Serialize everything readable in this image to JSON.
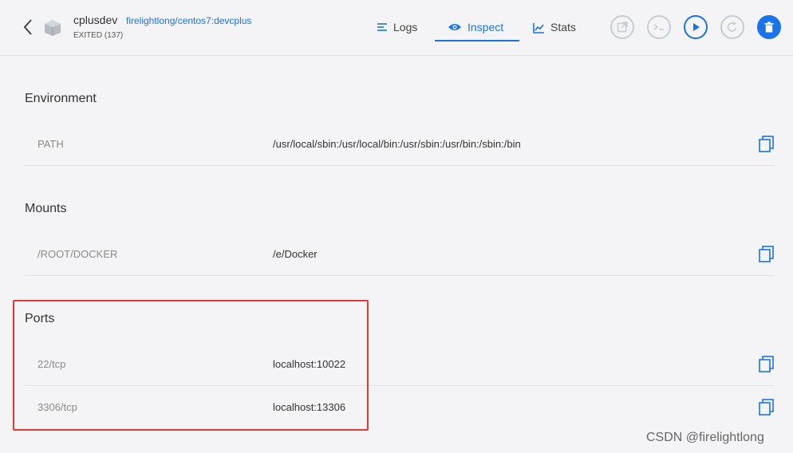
{
  "header": {
    "container_name": "cplusdev",
    "image_name": "firelightlong/centos7:devcplus",
    "status": "EXITED (137)",
    "tabs": [
      {
        "label": "Logs",
        "icon": "logs-icon",
        "active": false
      },
      {
        "label": "Inspect",
        "icon": "eye-icon",
        "active": true
      },
      {
        "label": "Stats",
        "icon": "stats-icon",
        "active": false
      }
    ],
    "actions": [
      "open-in-browser-icon",
      "cli-icon",
      "start-icon",
      "restart-icon",
      "delete-icon"
    ]
  },
  "environment": {
    "title": "Environment",
    "rows": [
      {
        "key": "PATH",
        "value": "/usr/local/sbin:/usr/local/bin:/usr/sbin:/usr/bin:/sbin:/bin"
      }
    ]
  },
  "mounts": {
    "title": "Mounts",
    "rows": [
      {
        "key": "/ROOT/DOCKER",
        "value": "/e/Docker"
      }
    ]
  },
  "ports": {
    "title": "Ports",
    "rows": [
      {
        "key": "22/tcp",
        "value": "localhost:10022"
      },
      {
        "key": "3306/tcp",
        "value": "localhost:13306"
      }
    ]
  },
  "watermark": "CSDN @firelightlong",
  "colors": {
    "accent": "#1a73e8",
    "highlight_border": "#e53935",
    "background": "#f4f4f6"
  }
}
